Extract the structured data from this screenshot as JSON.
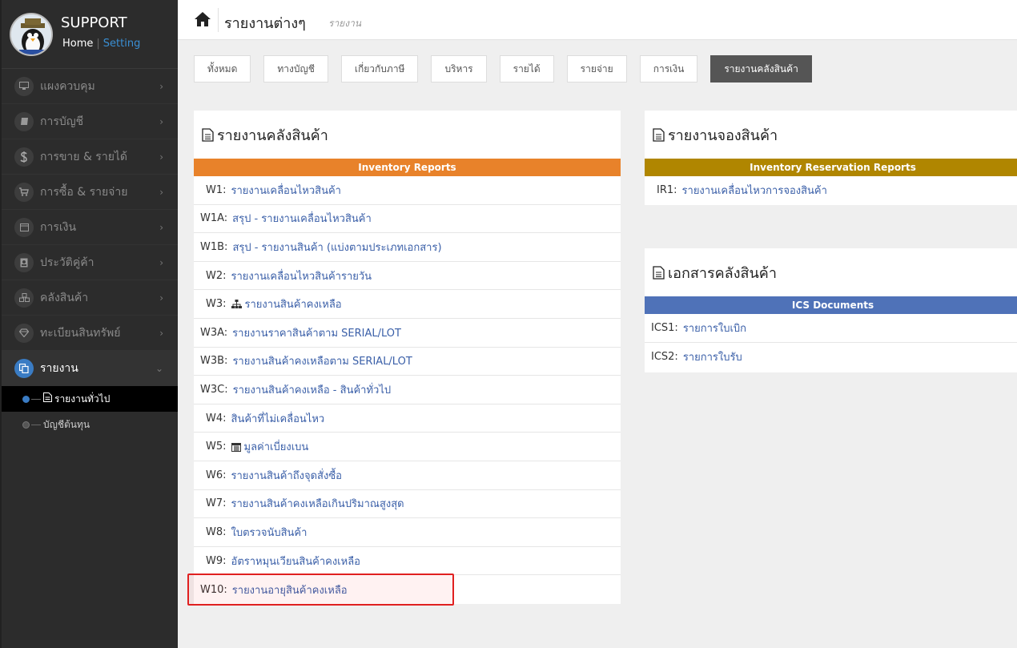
{
  "sidebar": {
    "brand_title": "SUPPORT",
    "home_link": "Home",
    "separator": "|",
    "setting_link": "Setting",
    "items": [
      {
        "label": "แผงควบคุม",
        "icon": "monitor-icon",
        "arrow": "›"
      },
      {
        "label": "การบัญชี",
        "icon": "book-icon",
        "arrow": "›"
      },
      {
        "label": "การขาย & รายได้",
        "icon": "dollar-icon",
        "arrow": "›"
      },
      {
        "label": "การซื้อ & รายจ่าย",
        "icon": "cart-icon",
        "arrow": "›"
      },
      {
        "label": "การเงิน",
        "icon": "calendar-icon",
        "arrow": "›"
      },
      {
        "label": "ประวัติคู่ค้า",
        "icon": "contact-card-icon",
        "arrow": "›"
      },
      {
        "label": "คลังสินค้า",
        "icon": "cubes-icon",
        "arrow": "›"
      },
      {
        "label": "ทะเบียนสินทรัพย์",
        "icon": "diamond-icon",
        "arrow": "›"
      },
      {
        "label": "รายงาน",
        "icon": "copy-icon",
        "arrow": "⌄"
      }
    ],
    "submenu": [
      {
        "label": "รายงานทั่วไป"
      },
      {
        "label": "บัญชีต้นทุน"
      }
    ]
  },
  "topbar": {
    "title": "รายงานต่างๆ",
    "subtitle": "รายงาน"
  },
  "tabs": [
    {
      "label": "ทั้งหมด"
    },
    {
      "label": "ทางบัญชี"
    },
    {
      "label": "เกี่ยวกับภาษี"
    },
    {
      "label": "บริหาร"
    },
    {
      "label": "รายได้"
    },
    {
      "label": "รายจ่าย"
    },
    {
      "label": "การเงิน"
    },
    {
      "label": "รายงานคลังสินค้า"
    }
  ],
  "inventory_panel": {
    "title": "รายงานคลังสินค้า",
    "header": "Inventory Reports",
    "rows": [
      {
        "code": "W1:",
        "text": "รายงานเคลื่อนไหวสินค้า"
      },
      {
        "code": "W1A:",
        "text": "สรุป - รายงานเคลื่อนไหวสินค้า"
      },
      {
        "code": "W1B:",
        "text": "สรุป - รายงานสินค้า (แบ่งตามประเภทเอกสาร)"
      },
      {
        "code": "W2:",
        "text": "รายงานเคลื่อนไหวสินค้ารายวัน"
      },
      {
        "code": "W3:",
        "text": "รายงานสินค้าคงเหลือ"
      },
      {
        "code": "W3A:",
        "text": "รายงานราคาสินค้าตาม SERIAL/LOT"
      },
      {
        "code": "W3B:",
        "text": "รายงานสินค้าคงเหลือตาม SERIAL/LOT"
      },
      {
        "code": "W3C:",
        "text": "รายงานสินค้าคงเหลือ - สินค้าทั่วไป"
      },
      {
        "code": "W4:",
        "text": "สินค้าที่ไม่เคลื่อนไหว"
      },
      {
        "code": "W5:",
        "text": "มูลค่าเบี่ยงเบน"
      },
      {
        "code": "W6:",
        "text": "รายงานสินค้าถึงจุดสั่งซื้อ"
      },
      {
        "code": "W7:",
        "text": "รายงานสินค้าคงเหลือเกินปริมาณสูงสุด"
      },
      {
        "code": "W8:",
        "text": "ใบตรวจนับสินค้า"
      },
      {
        "code": "W9:",
        "text": "อัตราหมุนเวียนสินค้าคงเหลือ"
      },
      {
        "code": "W10:",
        "text": "รายงานอายุสินค้าคงเหลือ"
      }
    ]
  },
  "reservation_panel": {
    "title": "รายงานจองสินค้า",
    "header": "Inventory Reservation Reports",
    "rows": [
      {
        "code": "IR1:",
        "text": "รายงานเคลื่อนไหวการจองสินค้า"
      }
    ]
  },
  "ics_panel": {
    "title": "เอกสารคลังสินค้า",
    "header": "ICS Documents",
    "rows": [
      {
        "code": "ICS1:",
        "text": "รายการใบเบิก"
      },
      {
        "code": "ICS2:",
        "text": "รายการใบรับ"
      }
    ]
  },
  "colors": {
    "inventory_header": "#e8822a",
    "reservation_header": "#b08600",
    "ics_header": "#4f72b8",
    "link": "#3a5fa8",
    "active_tab": "#555555",
    "highlight": "#e02020"
  }
}
